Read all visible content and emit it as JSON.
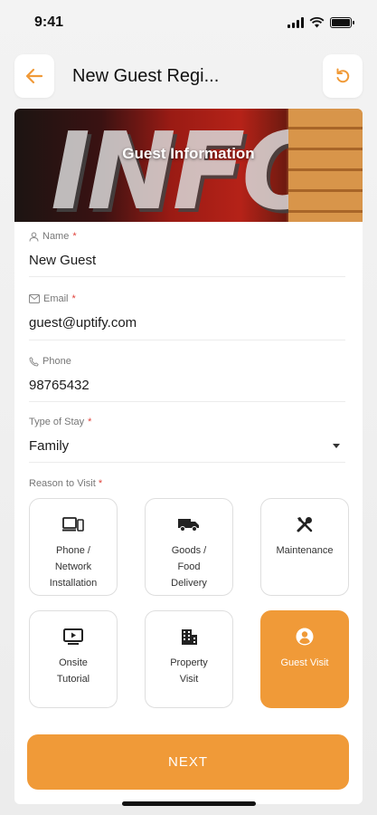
{
  "status_bar": {
    "time": "9:41"
  },
  "header": {
    "title": "New Guest Regi...",
    "back_icon": "arrow-left-icon",
    "reset_icon": "refresh-icon"
  },
  "banner": {
    "title": "Guest Information",
    "image_text": "INFO"
  },
  "form": {
    "name": {
      "label": "Name",
      "required": "*",
      "value": "New Guest"
    },
    "email": {
      "label": "Email",
      "required": "*",
      "value": "guest@uptify.com"
    },
    "phone": {
      "label": "Phone",
      "value": "98765432"
    },
    "stay_type": {
      "label": "Type of Stay",
      "required": "*",
      "value": "Family"
    },
    "reason": {
      "label": "Reason to Visit",
      "required": "*",
      "options": [
        {
          "label": "Phone /\nNetwork\nInstallation",
          "icon": "devices-icon",
          "selected": false
        },
        {
          "label": "Goods /\nFood\nDelivery",
          "icon": "truck-icon",
          "selected": false
        },
        {
          "label": "Maintenance",
          "icon": "tools-icon",
          "selected": false
        },
        {
          "label": "Onsite\nTutorial",
          "icon": "video-play-icon",
          "selected": false
        },
        {
          "label": "Property\nVisit",
          "icon": "building-icon",
          "selected": false
        },
        {
          "label": "Guest Visit",
          "icon": "user-circle-icon",
          "selected": true
        }
      ]
    }
  },
  "actions": {
    "next_label": "NEXT"
  },
  "colors": {
    "accent": "#f09a38",
    "required": "#e0433c"
  }
}
